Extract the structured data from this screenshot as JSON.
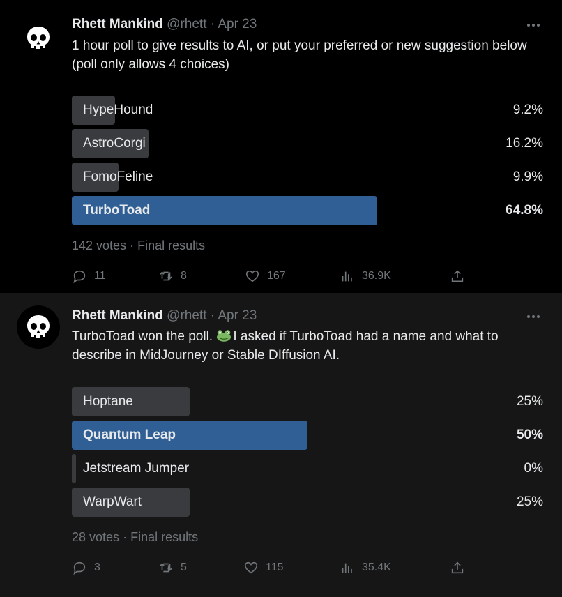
{
  "tweets": [
    {
      "author_name": "Rhett Mankind",
      "handle": "@rhett",
      "separator": "·",
      "date": "Apr 23",
      "text": "1 hour poll to give results to AI, or put your preferred or new suggestion below (poll only allows 4 choices)",
      "poll": {
        "options": [
          {
            "label": "HypeHound",
            "percent_text": "9.2%",
            "percent": 9.2,
            "winner": false
          },
          {
            "label": "AstroCorgi",
            "percent_text": "16.2%",
            "percent": 16.2,
            "winner": false
          },
          {
            "label": "FomoFeline",
            "percent_text": "9.9%",
            "percent": 9.9,
            "winner": false
          },
          {
            "label": "TurboToad",
            "percent_text": "64.8%",
            "percent": 64.8,
            "winner": true
          }
        ],
        "votes": "142 votes",
        "separator": "·",
        "status": "Final results"
      },
      "actions": {
        "replies": "11",
        "retweets": "8",
        "likes": "167",
        "views": "36.9K"
      }
    },
    {
      "author_name": "Rhett Mankind",
      "handle": "@rhett",
      "separator": "·",
      "date": "Apr 23",
      "text_before_emoji": "TurboToad won the poll. ",
      "emoji": "frog-face",
      "text_after_emoji": "I asked if TurboToad had a name and what to describe in MidJourney or Stable DIffusion AI.",
      "poll": {
        "options": [
          {
            "label": "Hoptane",
            "percent_text": "25%",
            "percent": 25,
            "winner": false
          },
          {
            "label": "Quantum Leap",
            "percent_text": "50%",
            "percent": 50,
            "winner": true
          },
          {
            "label": "Jetstream Jumper",
            "percent_text": "0%",
            "percent": 0,
            "winner": false
          },
          {
            "label": "WarpWart",
            "percent_text": "25%",
            "percent": 25,
            "winner": false
          }
        ],
        "votes": "28 votes",
        "separator": "·",
        "status": "Final results"
      },
      "actions": {
        "replies": "3",
        "retweets": "5",
        "likes": "115",
        "views": "35.4K"
      }
    }
  ],
  "colors": {
    "background": "#000000",
    "second_background": "#161616",
    "bar": "#3a3b3e",
    "winner_bar": "#2f5f95",
    "muted_text": "#71767b"
  }
}
